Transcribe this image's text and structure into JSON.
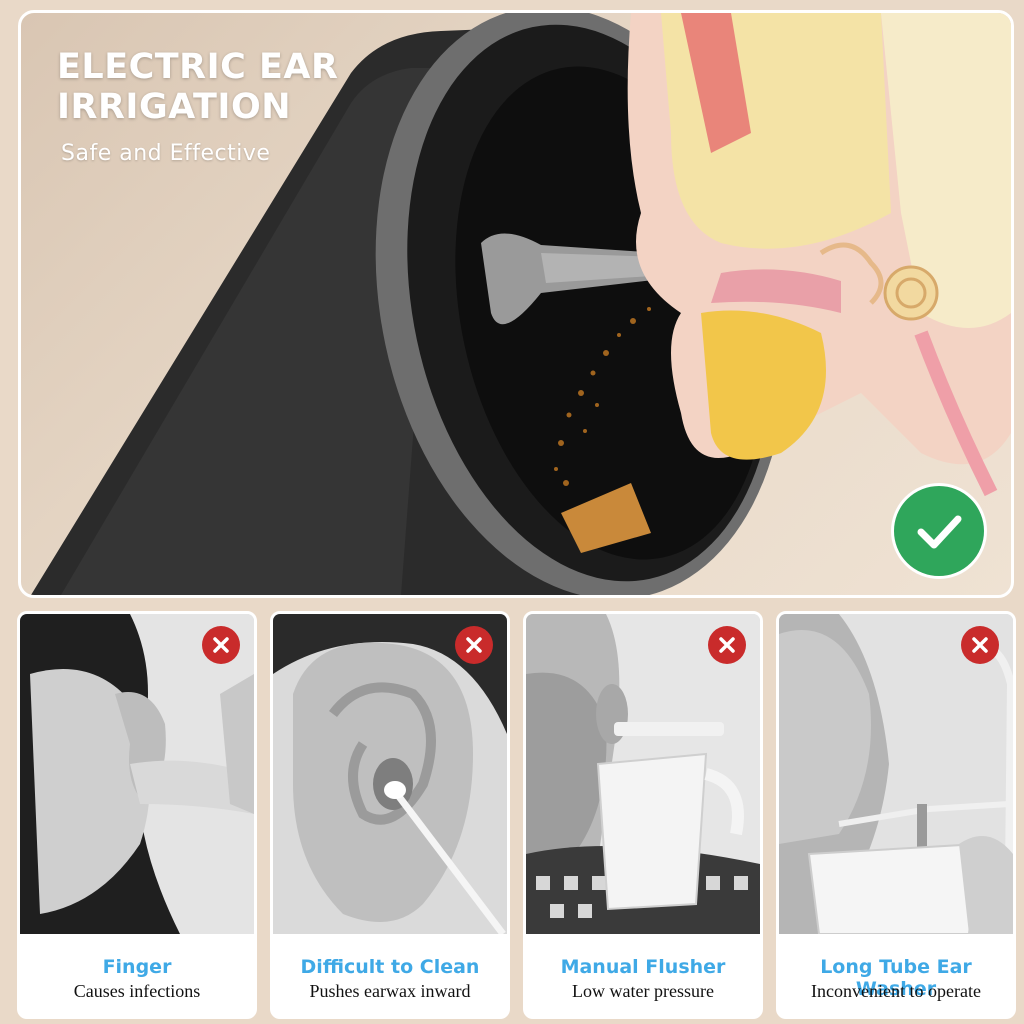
{
  "hero": {
    "title_line1": "ELECTRIC EAR",
    "title_line2": "IRRIGATION",
    "subtitle": "Safe and Effective",
    "badge_icon": "checkmark-icon",
    "badge_color": "#2fa65b"
  },
  "cards": [
    {
      "title": "Finger",
      "description": "Causes infections",
      "badge_icon": "cross-icon"
    },
    {
      "title": "Difficult to Clean",
      "description": "Pushes earwax inward",
      "badge_icon": "cross-icon"
    },
    {
      "title": "Manual Flusher",
      "description": "Low water pressure",
      "badge_icon": "cross-icon"
    },
    {
      "title": "Long Tube Ear Washer",
      "description": "Inconvenient to operate",
      "badge_icon": "cross-icon"
    }
  ],
  "colors": {
    "accent_title": "#3fa9e6",
    "error_badge": "#c92b2b",
    "background": "#e9d9c8"
  }
}
